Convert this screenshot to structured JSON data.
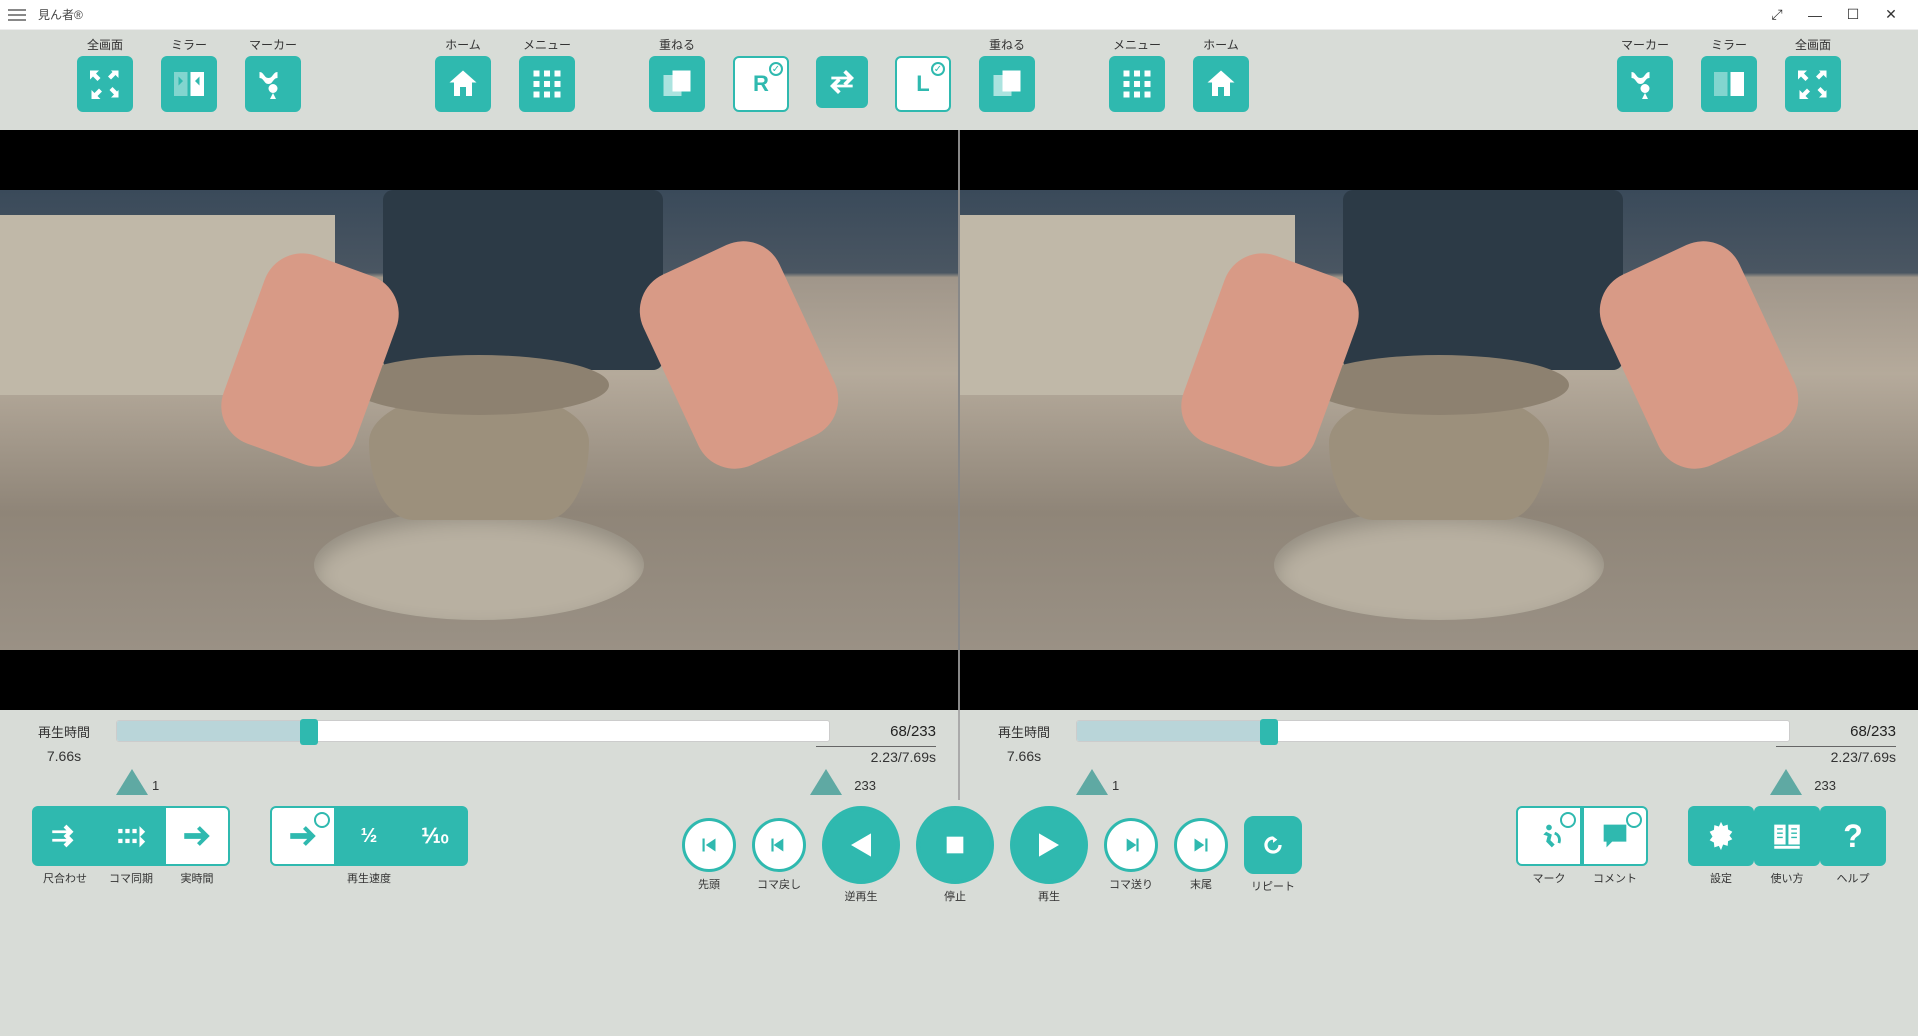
{
  "app": {
    "title": "見ん者®"
  },
  "toolbar": {
    "left": {
      "fullscreen": "全画面",
      "mirror": "ミラー",
      "marker": "マーカー",
      "home": "ホーム",
      "menu": "メニュー",
      "overlay": "重ねる"
    },
    "right": {
      "overlay": "重ねる",
      "menu": "メニュー",
      "home": "ホーム",
      "marker": "マーカー",
      "mirror": "ミラー",
      "fullscreen": "全画面"
    },
    "overlay_r": "R",
    "overlay_l": "L"
  },
  "slider": {
    "left": {
      "label": "再生時間",
      "time": "7.66s",
      "frame": "68/233",
      "dur": "2.23/7.69s",
      "mark_start": "1",
      "mark_end": "233"
    },
    "right": {
      "label": "再生時間",
      "time": "7.66s",
      "frame": "68/233",
      "dur": "2.23/7.69s",
      "mark_start": "1",
      "mark_end": "233"
    }
  },
  "bottom": {
    "scale_fit": "尺合わせ",
    "frame_sync": "コマ同期",
    "real_time": "実時間",
    "speed_label": "再生速度",
    "speed_half": "½",
    "speed_tenth": "⅒",
    "head": "先頭",
    "step_back": "コマ戻し",
    "play_rev": "逆再生",
    "stop": "停止",
    "play": "再生",
    "step_fwd": "コマ送り",
    "tail": "末尾",
    "repeat": "リピート",
    "mark": "マーク",
    "comment": "コメント",
    "settings": "設定",
    "howto": "使い方",
    "help": "ヘルプ"
  }
}
